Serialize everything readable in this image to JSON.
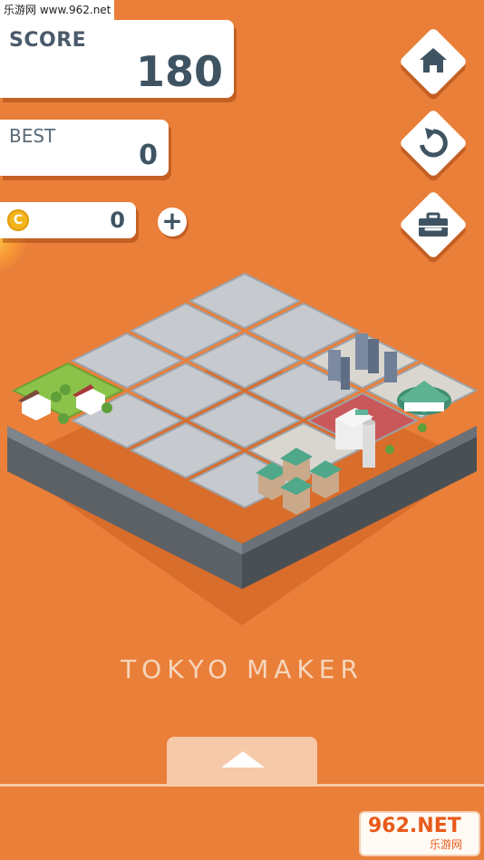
{
  "watermark": {
    "top": "乐游网 www.962.net",
    "bottom_main": "962.NET",
    "bottom_sub": "乐游网"
  },
  "score": {
    "label": "SCORE",
    "value": "180"
  },
  "best": {
    "label": "BEST",
    "value": "0"
  },
  "coins": {
    "icon_text": "C",
    "value": "0",
    "add_label": "+"
  },
  "buttons": {
    "home_icon": "home-icon",
    "restart_icon": "restart-icon",
    "toolbox_icon": "toolbox-icon"
  },
  "title": "TOKYO MAKER",
  "colors": {
    "background": "#ea7f39",
    "panel": "#ffffff",
    "text_dark": "#3f5463",
    "tile": "#c9ccd1",
    "grass": "#8bc34a",
    "drawer": "#f6c9a8"
  }
}
